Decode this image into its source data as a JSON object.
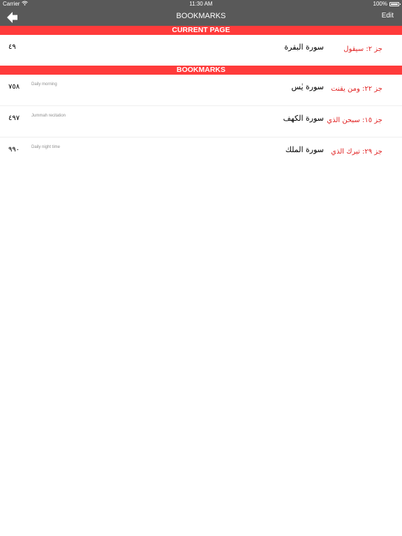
{
  "status_bar": {
    "carrier": "Carrier",
    "time": "11:30 AM",
    "battery": "100%"
  },
  "nav": {
    "title": "BOOKMARKS",
    "edit_label": "Edit",
    "back_icon": "arrow-left-icon"
  },
  "current_page": {
    "header": "CURRENT PAGE",
    "page": "٤٩",
    "surah": "سورة البقرة",
    "juz": "جز ٢: سيقول"
  },
  "bookmarks": {
    "header": "BOOKMARKS",
    "items": [
      {
        "page": "٧٥٨",
        "note": "Daily morning",
        "surah": "سورة يٰس",
        "juz": "جز ٢٢: ومن يقنت"
      },
      {
        "page": "٤٩٧",
        "note": "Jummah recitation",
        "surah": "سورة الكهف",
        "juz": "جز ١٥: سبحن الذي"
      },
      {
        "page": "٩٩٠",
        "note": "Daily night time",
        "surah": "سورة الملك",
        "juz": "جز ٢٩: تبرك الذي"
      }
    ]
  },
  "colors": {
    "bar": "#595959",
    "accent": "#ff3b3b",
    "juz_text": "#e02020"
  }
}
